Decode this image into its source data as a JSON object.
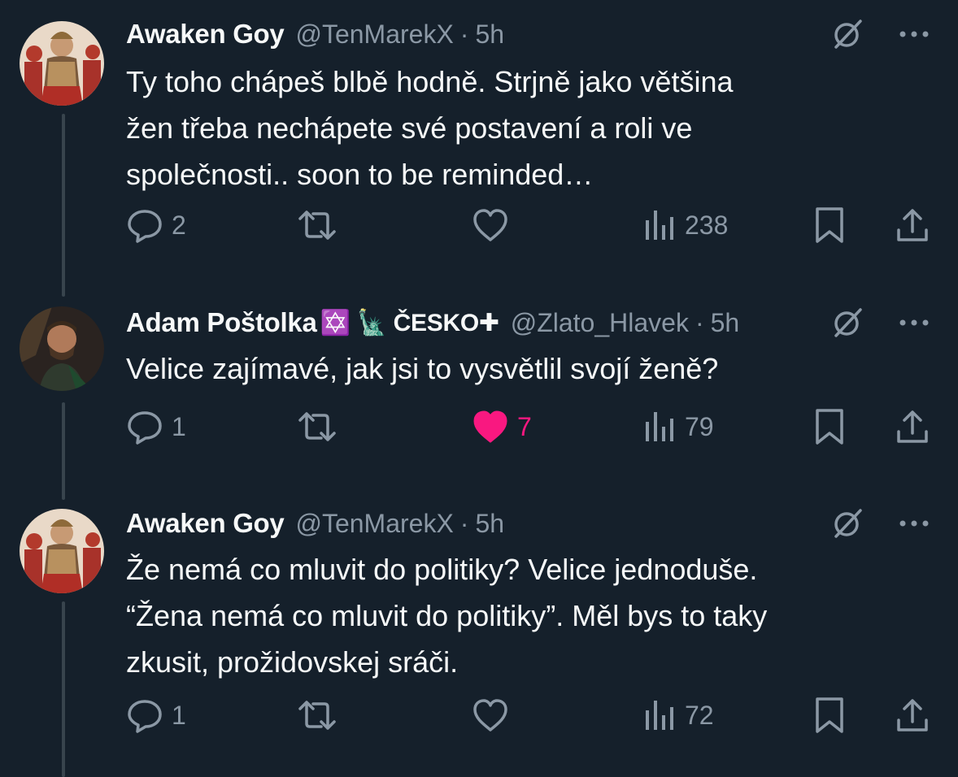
{
  "tweets": [
    {
      "name": "Awaken Goy",
      "handle": "@TenMarekX",
      "dot": "·",
      "time": "5h",
      "text": "Ty toho chápeš blbě hodně. Strjně jako většina\nžen třeba nechápete své postavení a roli ve\nspolečnosti.. soon to be reminded…",
      "replies": "2",
      "retweets": "",
      "likes": "",
      "liked": false,
      "views": "238"
    },
    {
      "name": "Adam Poštolka",
      "name_badges": "✡️ 🗽 ČESKO✚",
      "handle": "@Zlato_Hlavek",
      "dot": "·",
      "time": "5h",
      "text": "Velice zajímavé, jak jsi to vysvětlil svojí ženě?",
      "replies": "1",
      "retweets": "",
      "likes": "7",
      "liked": true,
      "views": "79"
    },
    {
      "name": "Awaken Goy",
      "handle": "@TenMarekX",
      "dot": "·",
      "time": "5h",
      "text": "Že nemá co mluvit do politiky? Velice jednoduše.\n“Žena nemá co mluvit do politiky”. Měl bys to taky\nzkusit, prožidovskej sráči.",
      "replies": "1",
      "retweets": "",
      "likes": "",
      "liked": false,
      "views": "72"
    }
  ],
  "colors": {
    "background": "#15202b",
    "text": "#f7f9f9",
    "secondary": "#8b98a5",
    "like": "#f91880",
    "thread": "#38444d"
  },
  "icons": [
    "grok-icon",
    "more-icon",
    "reply-icon",
    "retweet-icon",
    "like-icon",
    "views-icon",
    "bookmark-icon",
    "share-icon"
  ]
}
